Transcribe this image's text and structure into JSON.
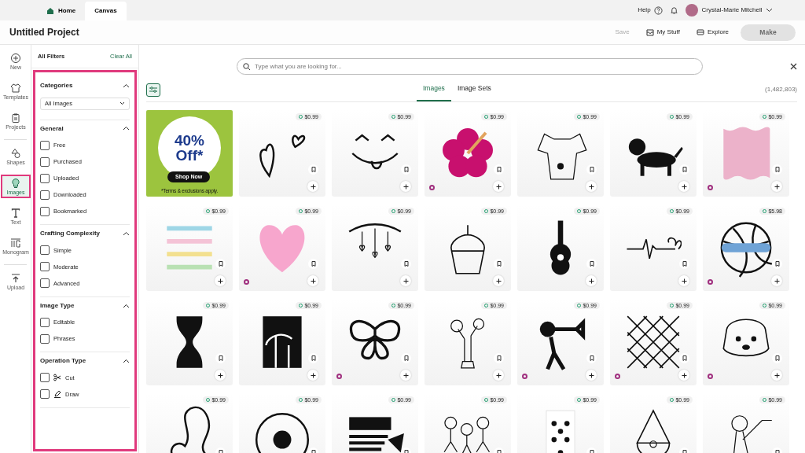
{
  "top_bar": {
    "tabs": [
      {
        "label": "Home",
        "selected": false,
        "kind": "home"
      },
      {
        "label": "Canvas",
        "selected": true,
        "kind": "plain"
      }
    ],
    "help": "Help",
    "user": "Crystal-Marie Mitchell"
  },
  "header": {
    "title": "Untitled Project",
    "actions": [
      {
        "label": "Save",
        "kind": "plain",
        "disabled": true
      },
      {
        "label": "My Stuff",
        "kind": "tray",
        "disabled": false
      },
      {
        "label": "Explore",
        "kind": "card",
        "disabled": false
      }
    ],
    "make": {
      "label": "Make",
      "disabled": true
    }
  },
  "rail": [
    {
      "label": "New",
      "kind": "plus",
      "selected": false
    },
    {
      "label": "Templates",
      "kind": "shirt",
      "selected": false
    },
    {
      "label": "Projects",
      "kind": "clipboard",
      "selected": false
    },
    {
      "label": "Shapes",
      "kind": "shapes",
      "selected": false
    },
    {
      "label": "Images",
      "kind": "bulb",
      "selected": true
    },
    {
      "label": "Text",
      "kind": "text",
      "selected": false
    },
    {
      "label": "Monogram",
      "kind": "monogram",
      "selected": false
    },
    {
      "label": "Upload",
      "kind": "upload",
      "selected": false
    }
  ],
  "filters": {
    "title": "All Filters",
    "clear": "Clear All",
    "sections": [
      {
        "title": "Categories",
        "expanded": true,
        "select": "All Images"
      },
      {
        "title": "General",
        "expanded": true,
        "options": [
          {
            "label": "Free",
            "checked": false
          },
          {
            "label": "Purchased",
            "checked": false
          },
          {
            "label": "Uploaded",
            "checked": false
          },
          {
            "label": "Downloaded",
            "checked": false
          },
          {
            "label": "Bookmarked",
            "checked": false
          }
        ]
      },
      {
        "title": "Crafting Complexity",
        "expanded": true,
        "options": [
          {
            "label": "Simple",
            "checked": false
          },
          {
            "label": "Moderate",
            "checked": false
          },
          {
            "label": "Advanced",
            "checked": false
          }
        ]
      },
      {
        "title": "Image Type",
        "expanded": true,
        "options": [
          {
            "label": "Editable",
            "checked": false
          },
          {
            "label": "Phrases",
            "checked": false
          }
        ]
      },
      {
        "title": "Operation Type",
        "expanded": true,
        "options": [
          {
            "label": "Cut",
            "checked": false,
            "kind": "cut"
          },
          {
            "label": "Draw",
            "checked": false,
            "kind": "draw"
          }
        ]
      }
    ]
  },
  "search": {
    "placeholder": "Type what you are looking for..."
  },
  "tabs": [
    {
      "label": "Images",
      "selected": true
    },
    {
      "label": "Image Sets",
      "selected": false
    }
  ],
  "count": "(1,482,803)",
  "promo": {
    "headline": "40%",
    "subline": "Off*",
    "button": "Shop Now",
    "note": "*Terms & exclusions apply."
  },
  "tiles": [
    {
      "kind": "hearts",
      "price": "$0.99",
      "subscription": false
    },
    {
      "kind": "smiley",
      "price": "$0.99",
      "subscription": false
    },
    {
      "kind": "flower",
      "price": "$0.99",
      "subscription": true
    },
    {
      "kind": "dog",
      "price": "$0.99",
      "subscription": false
    },
    {
      "kind": "dachshund",
      "price": "$0.99",
      "subscription": false
    },
    {
      "kind": "frame",
      "price": "$0.99",
      "subscription": true
    },
    {
      "kind": "stripes",
      "price": "$0.99",
      "subscription": false
    },
    {
      "kind": "pinkheart",
      "price": "$0.99",
      "subscription": true
    },
    {
      "kind": "branch",
      "price": "$0.99",
      "subscription": false
    },
    {
      "kind": "cupcake",
      "price": "$0.99",
      "subscription": false
    },
    {
      "kind": "guitar",
      "price": "$0.99",
      "subscription": false
    },
    {
      "kind": "heartbeat",
      "price": "$0.99",
      "subscription": false
    },
    {
      "kind": "ball",
      "price": "$5.98",
      "subscription": true
    },
    {
      "kind": "hourglass",
      "price": "$0.99",
      "subscription": false
    },
    {
      "kind": "palm",
      "price": "$0.99",
      "subscription": false
    },
    {
      "kind": "butterfly",
      "price": "$0.99",
      "subscription": true
    },
    {
      "kind": "hand",
      "price": "$0.99",
      "subscription": false
    },
    {
      "kind": "trumpeter",
      "price": "$0.99",
      "subscription": true
    },
    {
      "kind": "lattice",
      "price": "$0.99",
      "subscription": true
    },
    {
      "kind": "puppy",
      "price": "$0.99",
      "subscription": true
    },
    {
      "kind": "leo",
      "price": "$0.99"
    },
    {
      "kind": "ring",
      "price": "$0.99"
    },
    {
      "kind": "banner",
      "price": "$0.99"
    },
    {
      "kind": "kids",
      "price": "$0.99"
    },
    {
      "kind": "card",
      "price": "$0.99"
    },
    {
      "kind": "gnome",
      "price": "$0.99"
    },
    {
      "kind": "frog",
      "price": "$0.99"
    }
  ]
}
